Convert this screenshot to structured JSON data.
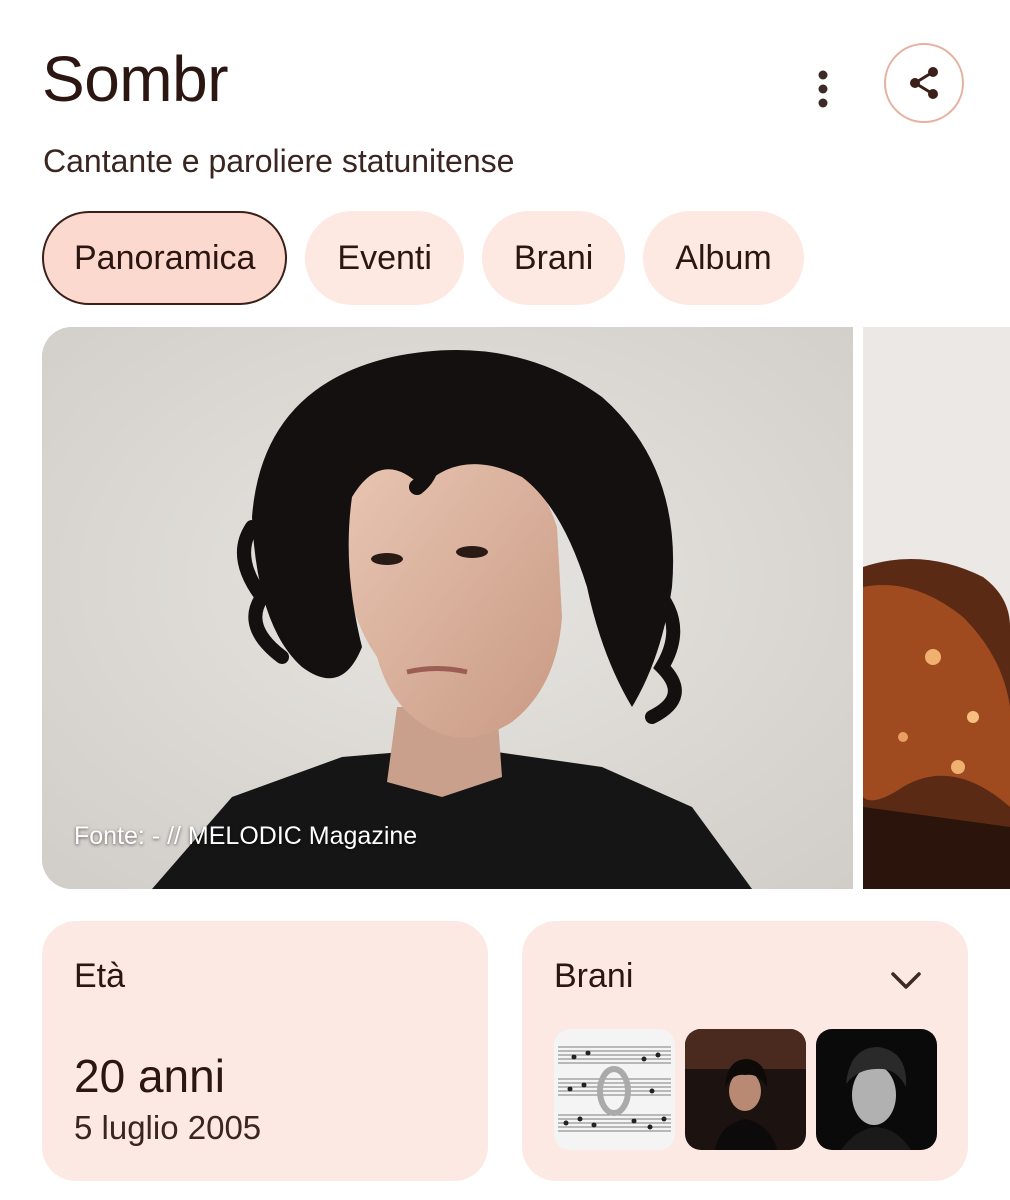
{
  "header": {
    "title": "Sombr",
    "subtitle": "Cantante e paroliere statunitense",
    "more_icon": "more-vert-icon",
    "share_icon": "share-icon"
  },
  "tabs": [
    {
      "label": "Panoramica",
      "active": true
    },
    {
      "label": "Eventi",
      "active": false
    },
    {
      "label": "Brani",
      "active": false
    },
    {
      "label": "Album",
      "active": false
    }
  ],
  "hero": {
    "caption": "Fonte: - // MELODIC Magazine"
  },
  "age_card": {
    "label": "Età",
    "value": "20 anni",
    "date": "5 luglio 2005"
  },
  "songs_card": {
    "label": "Brani",
    "chevron_icon": "chevron-down-icon",
    "thumb_count_visible": 3
  },
  "colors": {
    "text": "#2b1612",
    "chip_bg": "#fde8e2",
    "chip_active_bg": "#fcd9cf",
    "card_bg": "#fde9e3",
    "share_border": "#e5b1a0"
  }
}
